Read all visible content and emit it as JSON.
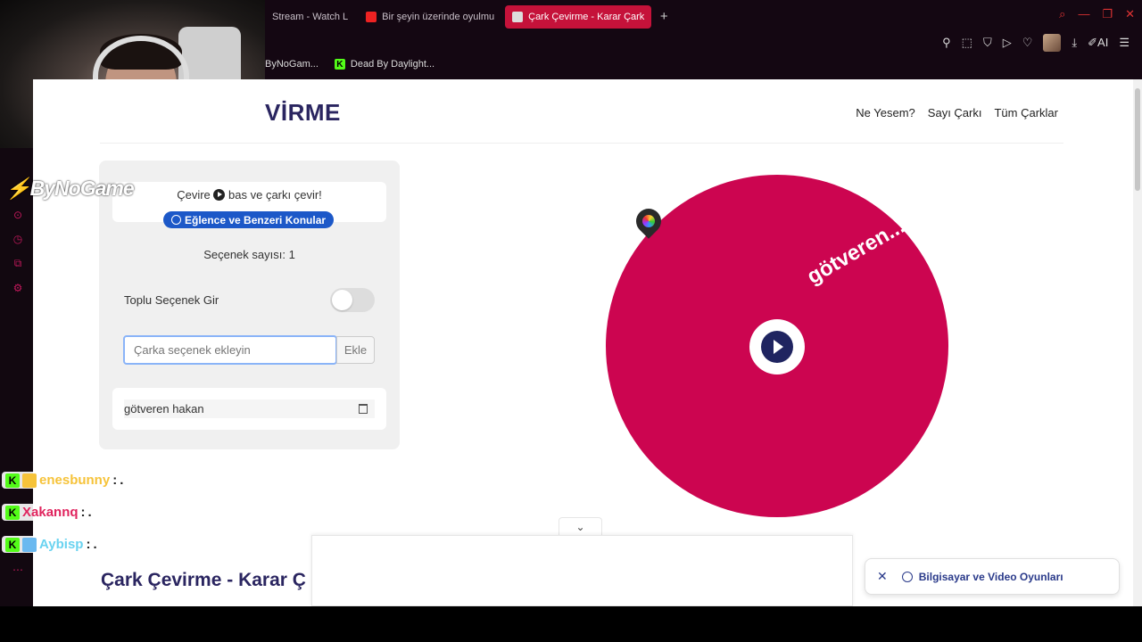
{
  "browser": {
    "tabs": [
      {
        "label": "Stream - Watch L"
      },
      {
        "label": "Bir şeyin üzerinde oyulmu"
      },
      {
        "label": "Çark Çevirme - Karar Çark"
      }
    ],
    "new_tab": "+",
    "bookmarks": [
      {
        "label": "ByNoGam..."
      },
      {
        "label": "Dead By Daylight..."
      }
    ],
    "ai_label": "AI"
  },
  "stream_overlay": {
    "channel_logo": "ByNoGame",
    "chat": [
      {
        "user": "enesbunny",
        "sep": ":",
        "message": ".",
        "color": "#f6c33a"
      },
      {
        "user": "Xakannq",
        "sep": ":",
        "message": ".",
        "color": "#e0245e"
      },
      {
        "user": "Aybisp",
        "sep": ":",
        "message": ".",
        "color": "#6ad3f0"
      }
    ]
  },
  "site": {
    "title_fragment": "VİRME",
    "nav": [
      "Ne Yesem?",
      "Sayı Çarkı",
      "Tüm Çarklar"
    ]
  },
  "panel": {
    "info_text_pre": "Çevire",
    "info_text_post": "bas ve çarkı çevir!",
    "category_badge": "Eğlence ve Benzeri Konular",
    "option_count": "Seçenek sayısı: 1",
    "bulk_toggle_label": "Toplu Seçenek Gir",
    "bulk_toggle_on": false,
    "input_placeholder": "Çarka seçenek ekleyin",
    "add_button": "Ekle",
    "options": [
      {
        "label": "götveren hakan"
      }
    ]
  },
  "wheel": {
    "segment_label": "götveren...",
    "color": "#cc0550"
  },
  "bottom": {
    "heading": "Çark Çevirme - Karar Ç",
    "suggestion": "Bilgisayar ve Video Oyunları"
  },
  "icons": {
    "collapse": "chevron-down-icon",
    "close": "close-icon"
  }
}
